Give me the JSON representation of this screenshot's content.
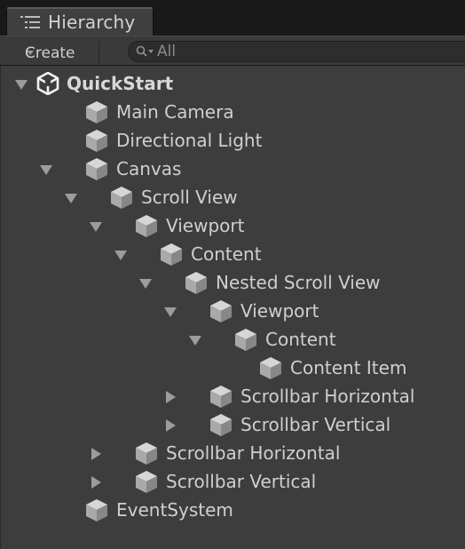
{
  "tab": {
    "title": "Hierarchy"
  },
  "toolbar": {
    "create_label": "Create",
    "search_placeholder": "All"
  },
  "tree": [
    {
      "label": "QuickStart",
      "depth": 0,
      "arrow": "expanded",
      "icon": "unity-scene-icon",
      "root": true
    },
    {
      "label": "Main Camera",
      "depth": 1,
      "arrow": "none",
      "icon": "gameobject-cube-icon"
    },
    {
      "label": "Directional Light",
      "depth": 1,
      "arrow": "none",
      "icon": "gameobject-cube-icon"
    },
    {
      "label": "Canvas",
      "depth": 1,
      "arrow": "expanded",
      "icon": "gameobject-cube-icon"
    },
    {
      "label": "Scroll View",
      "depth": 2,
      "arrow": "expanded",
      "icon": "gameobject-cube-icon"
    },
    {
      "label": "Viewport",
      "depth": 3,
      "arrow": "expanded",
      "icon": "gameobject-cube-icon"
    },
    {
      "label": "Content",
      "depth": 4,
      "arrow": "expanded",
      "icon": "gameobject-cube-icon"
    },
    {
      "label": "Nested Scroll View",
      "depth": 5,
      "arrow": "expanded",
      "icon": "gameobject-cube-icon"
    },
    {
      "label": "Viewport",
      "depth": 6,
      "arrow": "expanded",
      "icon": "gameobject-cube-icon"
    },
    {
      "label": "Content",
      "depth": 7,
      "arrow": "expanded",
      "icon": "gameobject-cube-icon"
    },
    {
      "label": "Content Item",
      "depth": 8,
      "arrow": "none",
      "icon": "gameobject-cube-icon"
    },
    {
      "label": "Scrollbar Horizontal",
      "depth": 6,
      "arrow": "collapsed",
      "icon": "gameobject-cube-icon"
    },
    {
      "label": "Scrollbar Vertical",
      "depth": 6,
      "arrow": "collapsed",
      "icon": "gameobject-cube-icon"
    },
    {
      "label": "Scrollbar Horizontal",
      "depth": 3,
      "arrow": "collapsed",
      "icon": "gameobject-cube-icon"
    },
    {
      "label": "Scrollbar Vertical",
      "depth": 3,
      "arrow": "collapsed",
      "icon": "gameobject-cube-icon"
    },
    {
      "label": "EventSystem",
      "depth": 1,
      "arrow": "none",
      "icon": "gameobject-cube-icon"
    }
  ]
}
